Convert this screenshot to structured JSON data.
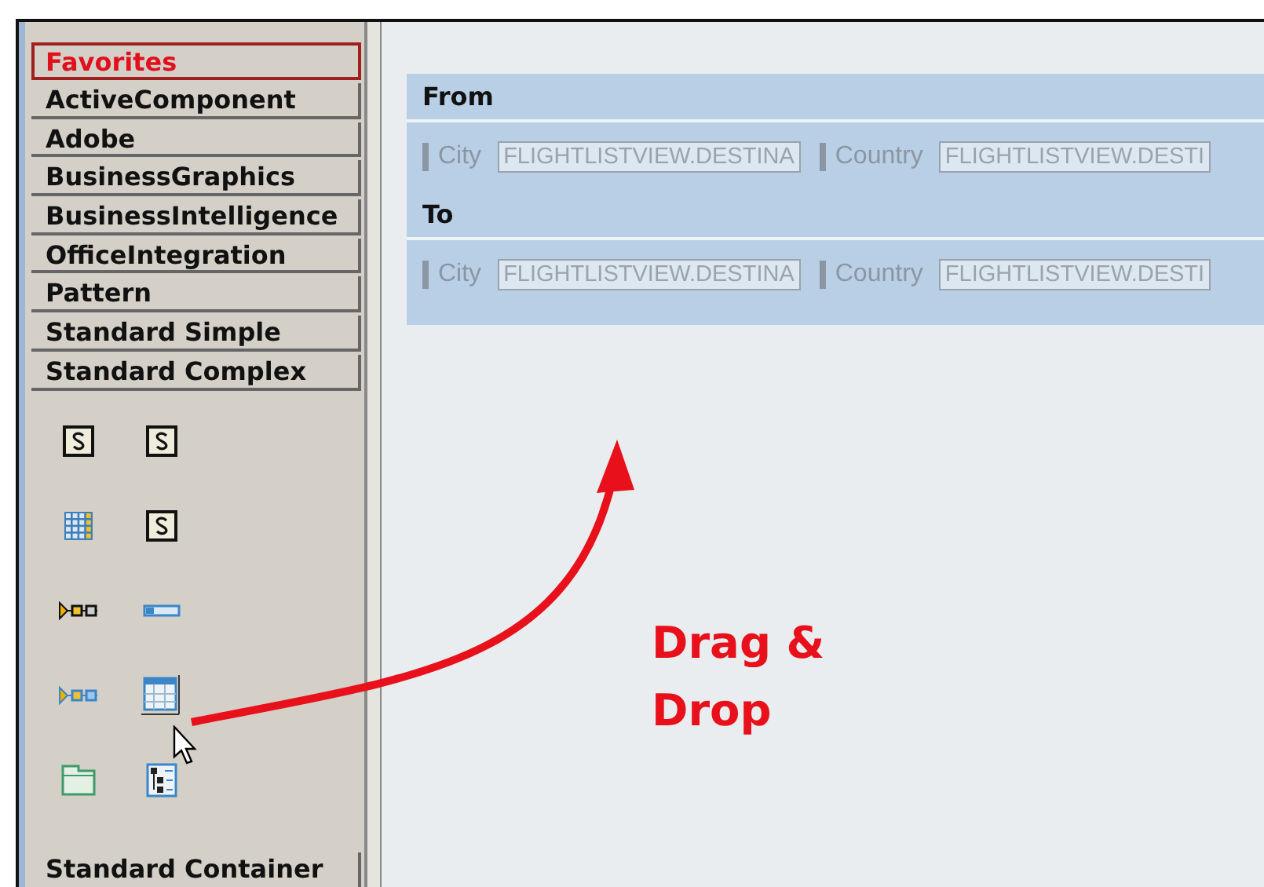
{
  "palette": {
    "categories": [
      {
        "label": "Favorites",
        "selected": true
      },
      {
        "label": "ActiveComponent",
        "selected": false
      },
      {
        "label": "Adobe",
        "selected": false
      },
      {
        "label": "BusinessGraphics",
        "selected": false
      },
      {
        "label": "BusinessIntelligence",
        "selected": false
      },
      {
        "label": "OfficeIntegration",
        "selected": false
      },
      {
        "label": "Pattern",
        "selected": false
      },
      {
        "label": "Standard Simple",
        "selected": false
      },
      {
        "label": "Standard Complex",
        "selected": false
      }
    ],
    "tools": [
      {
        "kind": "text"
      },
      {
        "kind": "text"
      },
      {
        "kind": "grid"
      },
      {
        "kind": "text"
      },
      {
        "kind": "sequence"
      },
      {
        "kind": "bar"
      },
      {
        "kind": "roadmap"
      },
      {
        "kind": "table"
      },
      {
        "kind": "tabstrip"
      },
      {
        "kind": "tree"
      }
    ],
    "next_category": {
      "label": "Standard Container",
      "selected": false
    }
  },
  "form": {
    "sections": [
      {
        "title": "From",
        "fields": [
          {
            "label": "City",
            "value": "FLIGHTLISTVIEW.DESTINA"
          },
          {
            "label": "Country",
            "value": "FLIGHTLISTVIEW.DESTI"
          }
        ]
      },
      {
        "title": "To",
        "fields": [
          {
            "label": "City",
            "value": "FLIGHTLISTVIEW.DESTINA"
          },
          {
            "label": "Country",
            "value": "FLIGHTLISTVIEW.DESTI"
          }
        ]
      }
    ]
  },
  "annotation": {
    "lines": [
      "Drag &",
      "Drop"
    ]
  }
}
